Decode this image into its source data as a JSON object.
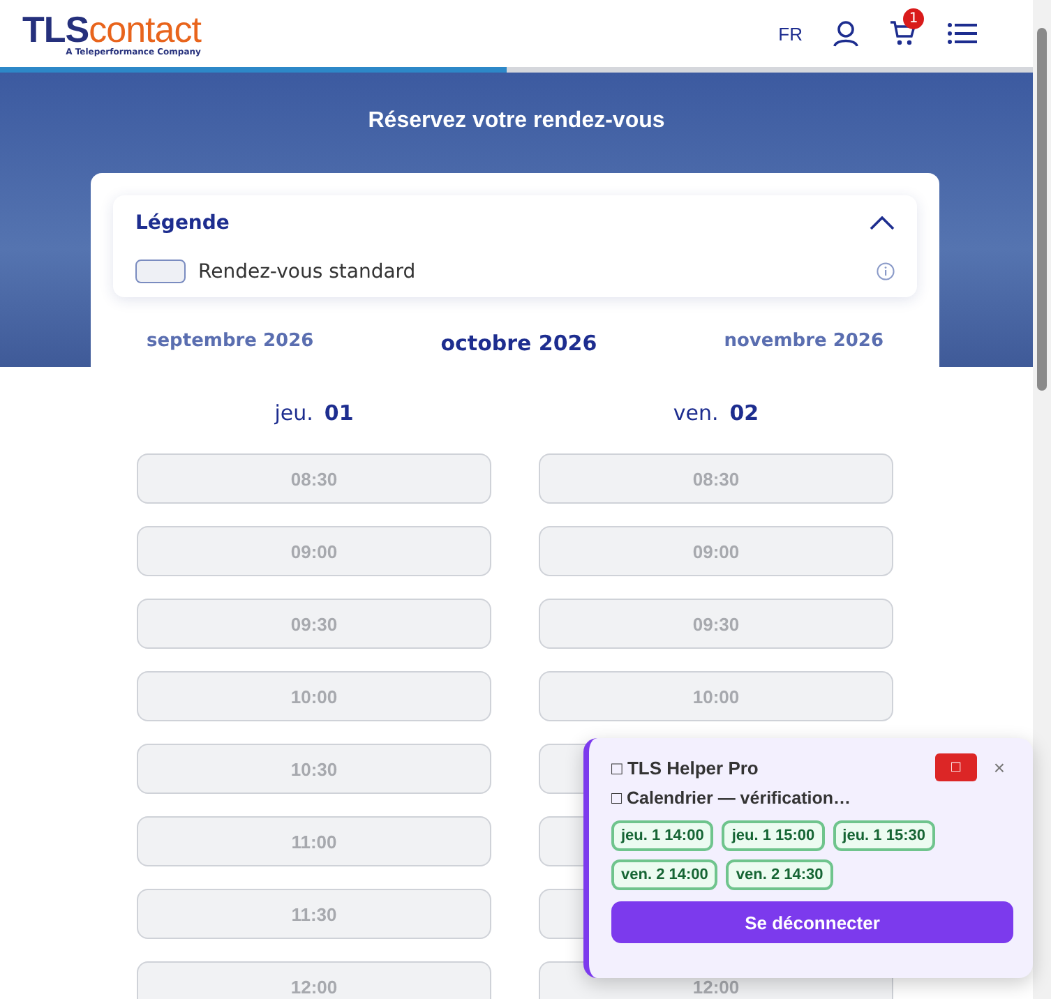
{
  "header": {
    "logo_main": "TLS",
    "logo_accent": "contact",
    "logo_tagline": "A Teleperformance Company",
    "language": "FR",
    "cart_count": "1"
  },
  "progress": {
    "level": 0.49
  },
  "hero": {
    "title": "Réservez votre rendez-vous"
  },
  "legend": {
    "title": "Légende",
    "expanded": true,
    "items": [
      {
        "label": "Rendez-vous standard"
      }
    ]
  },
  "months": [
    {
      "label": "septembre 2026",
      "selected": false
    },
    {
      "label": "octobre 2026",
      "selected": true
    },
    {
      "label": "novembre 2026",
      "selected": false
    }
  ],
  "days": [
    {
      "weekday": "jeu.",
      "day": "01",
      "slots": [
        {
          "time": "08:30",
          "disabled": true
        },
        {
          "time": "09:00",
          "disabled": true
        },
        {
          "time": "09:30",
          "disabled": true
        },
        {
          "time": "10:00",
          "disabled": true
        },
        {
          "time": "10:30",
          "disabled": true
        },
        {
          "time": "11:00",
          "disabled": true
        },
        {
          "time": "11:30",
          "disabled": true
        },
        {
          "time": "12:00",
          "disabled": true
        }
      ]
    },
    {
      "weekday": "ven.",
      "day": "02",
      "slots": [
        {
          "time": "08:30",
          "disabled": true
        },
        {
          "time": "09:00",
          "disabled": true
        },
        {
          "time": "09:30",
          "disabled": true
        },
        {
          "time": "10:00",
          "disabled": true
        },
        {
          "disabled": true
        },
        {
          "disabled": true
        },
        {
          "disabled": true
        },
        {
          "time": "12:00",
          "disabled": true
        }
      ]
    }
  ],
  "helper": {
    "title": "□ TLS Helper Pro",
    "stop_button": "□",
    "close": "×",
    "status": "□ Calendrier — vérification…",
    "found": [
      {
        "label": "jeu. 1 14:00"
      },
      {
        "label": "jeu. 1 15:00"
      },
      {
        "label": "jeu. 1 15:30"
      },
      {
        "label": "ven. 2 14:00"
      },
      {
        "label": "ven. 2 14:30"
      }
    ],
    "logout": "Se déconnecter"
  }
}
